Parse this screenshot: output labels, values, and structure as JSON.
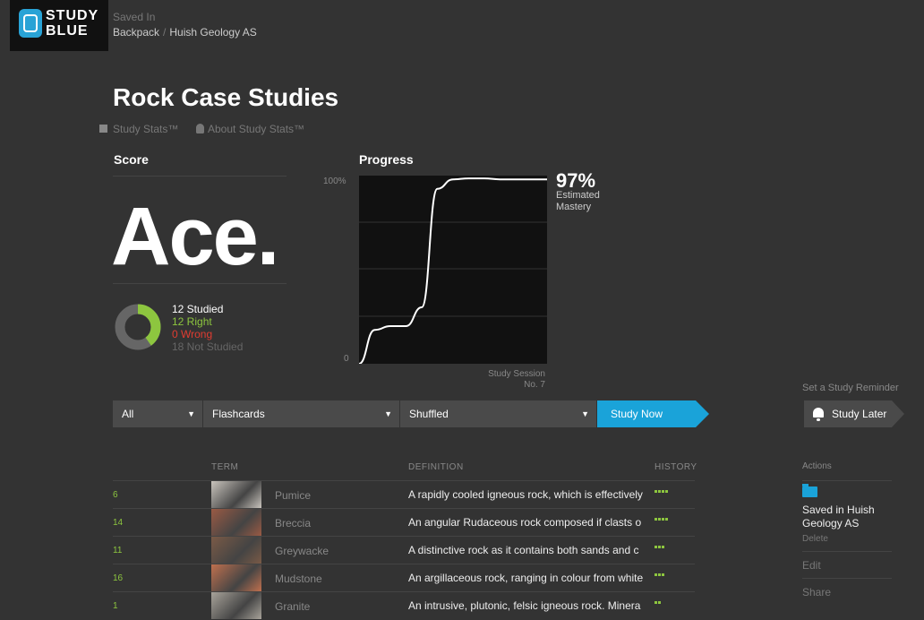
{
  "brand": {
    "logo_line1": "STUDY",
    "logo_line2": "BLUE"
  },
  "breadcrumb": {
    "label": "Saved In",
    "items": [
      "Backpack",
      "Huish Geology AS"
    ],
    "separator": "/"
  },
  "page_title": "Rock Case Studies",
  "study_stats": {
    "toggle_label": "Study Stats™",
    "about_label": "About Study Stats™"
  },
  "score": {
    "header": "Score",
    "grade": "Ace.",
    "studied": "12 Studied",
    "right": "12 Right",
    "wrong": "0 Wrong",
    "not_studied": "18 Not Studied",
    "studied_fraction": 0.4,
    "colors": {
      "right": "#8dc63f",
      "wrong": "#e03c31",
      "not_studied": "#666666"
    }
  },
  "progress": {
    "header": "Progress",
    "mastery_value": "97%",
    "mastery_label_line1": "Estimated",
    "mastery_label_line2": "Mastery",
    "y_max_label": "100%",
    "y_min_label": "0",
    "session_label_line1": "Study Session",
    "session_label_line2": "No. 7"
  },
  "chart_data": {
    "type": "line",
    "ylim": [
      0,
      100
    ],
    "x": [
      0,
      0.5,
      1,
      1.5,
      2,
      2.5,
      3,
      3.5,
      4,
      4.5,
      5,
      5.5,
      6
    ],
    "values": [
      0,
      18,
      20,
      20,
      30,
      93,
      98,
      98.5,
      98.5,
      98,
      98,
      98,
      98
    ]
  },
  "controls": {
    "filter": "All",
    "mode": "Flashcards",
    "order": "Shuffled",
    "study_now": "Study Now"
  },
  "reminder": {
    "label": "Set a Study Reminder",
    "button": "Study Later"
  },
  "table": {
    "headers": {
      "term": "TERM",
      "definition": "DEFINITION",
      "history": "HISTORY"
    },
    "rows": [
      {
        "count": "6",
        "term": "Pumice",
        "definition": "A rapidly cooled igneous rock, which is effectively",
        "thumb": "#c9c4bd",
        "history": 4
      },
      {
        "count": "14",
        "term": "Breccia",
        "definition": "An angular Rudaceous rock composed if clasts o",
        "thumb": "#9a5a44",
        "history": 4
      },
      {
        "count": "11",
        "term": "Greywacke",
        "definition": "A distinctive rock as it contains both sands and c",
        "thumb": "#7a5a46",
        "history": 3
      },
      {
        "count": "16",
        "term": "Mudstone",
        "definition": "An argillaceous rock, ranging in colour from white",
        "thumb": "#c0704e",
        "history": 3
      },
      {
        "count": "1",
        "term": "Granite",
        "definition": "An intrusive, plutonic, felsic igneous rock. Minera",
        "thumb": "#a8a39a",
        "history": 2
      }
    ]
  },
  "actions": {
    "label": "Actions",
    "saved_line1": "Saved in Huish",
    "saved_line2": "Geology AS",
    "delete": "Delete",
    "edit": "Edit",
    "share": "Share"
  }
}
